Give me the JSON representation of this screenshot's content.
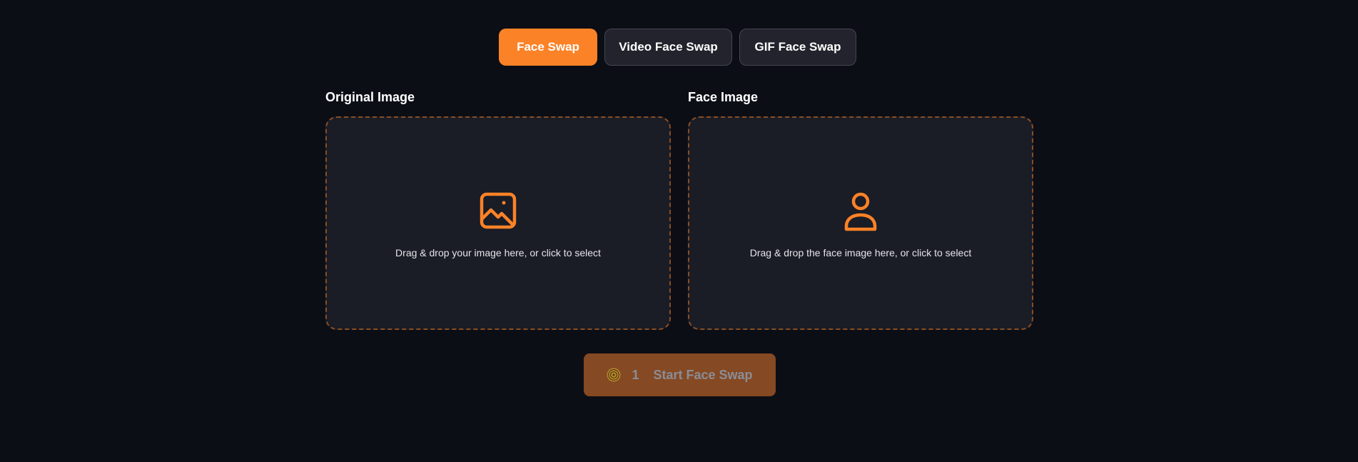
{
  "tabs": [
    {
      "label": "Face Swap",
      "active": true
    },
    {
      "label": "Video Face Swap",
      "active": false
    },
    {
      "label": "GIF Face Swap",
      "active": false
    }
  ],
  "original": {
    "label": "Original Image",
    "prompt": "Drag & drop your image here, or click to select",
    "icon": "image-icon"
  },
  "face": {
    "label": "Face Image",
    "prompt": "Drag & drop the face image here, or click to select",
    "icon": "user-icon"
  },
  "start": {
    "credits": "1",
    "label": "Start Face Swap",
    "icon": "coin-icon"
  },
  "colors": {
    "background": "#0c0e16",
    "accent": "#fb8227",
    "panel": "#1a1c26",
    "dashed_border": "#8a4e22",
    "button_disabled": "#854923"
  }
}
